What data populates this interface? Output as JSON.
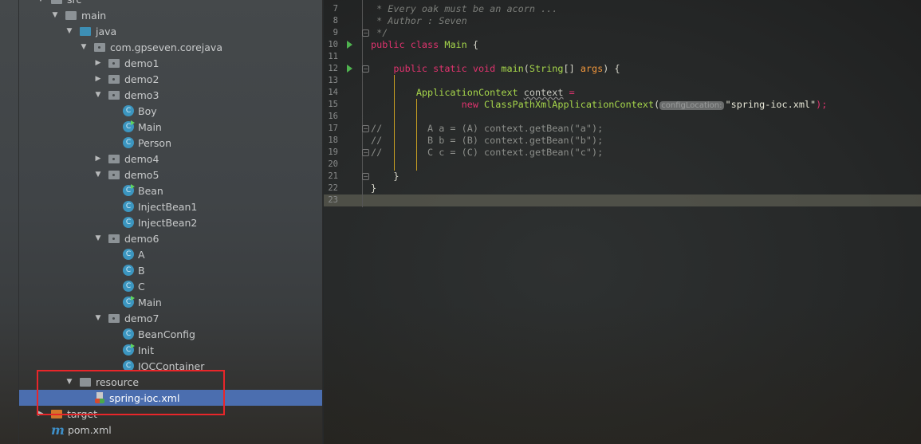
{
  "project_tree": {
    "items": [
      {
        "label": "src",
        "kind": "folder",
        "depth": 0,
        "arrow": "down"
      },
      {
        "label": "main",
        "kind": "folder",
        "depth": 1,
        "arrow": "down"
      },
      {
        "label": "java",
        "kind": "src",
        "depth": 2,
        "arrow": "down"
      },
      {
        "label": "com.gpseven.corejava",
        "kind": "pkg",
        "depth": 3,
        "arrow": "down"
      },
      {
        "label": "demo1",
        "kind": "pkg",
        "depth": 4,
        "arrow": "right"
      },
      {
        "label": "demo2",
        "kind": "pkg",
        "depth": 4,
        "arrow": "right"
      },
      {
        "label": "demo3",
        "kind": "pkg",
        "depth": 4,
        "arrow": "down"
      },
      {
        "label": "Boy",
        "kind": "class",
        "depth": 5
      },
      {
        "label": "Main",
        "kind": "class-run",
        "depth": 5
      },
      {
        "label": "Person",
        "kind": "class",
        "depth": 5
      },
      {
        "label": "demo4",
        "kind": "pkg",
        "depth": 4,
        "arrow": "right"
      },
      {
        "label": "demo5",
        "kind": "pkg",
        "depth": 4,
        "arrow": "down"
      },
      {
        "label": "Bean",
        "kind": "class-run",
        "depth": 5
      },
      {
        "label": "InjectBean1",
        "kind": "class",
        "depth": 5
      },
      {
        "label": "InjectBean2",
        "kind": "class",
        "depth": 5
      },
      {
        "label": "demo6",
        "kind": "pkg",
        "depth": 4,
        "arrow": "down"
      },
      {
        "label": "A",
        "kind": "class",
        "depth": 5
      },
      {
        "label": "B",
        "kind": "class",
        "depth": 5
      },
      {
        "label": "C",
        "kind": "class",
        "depth": 5
      },
      {
        "label": "Main",
        "kind": "class-run",
        "depth": 5
      },
      {
        "label": "demo7",
        "kind": "pkg",
        "depth": 4,
        "arrow": "down"
      },
      {
        "label": "BeanConfig",
        "kind": "class",
        "depth": 5
      },
      {
        "label": "Init",
        "kind": "class-run",
        "depth": 5
      },
      {
        "label": "IOCContainer",
        "kind": "class",
        "depth": 5
      },
      {
        "label": "resource",
        "kind": "folder",
        "depth": 2,
        "arrow": "down"
      },
      {
        "label": "spring-ioc.xml",
        "kind": "xml",
        "depth": 3,
        "selected": true
      },
      {
        "label": "target",
        "kind": "target",
        "depth": 0,
        "arrow": "right"
      },
      {
        "label": "pom.xml",
        "kind": "maven",
        "depth": 0
      }
    ],
    "class_icon_letter": "C",
    "maven_icon_letter": "m",
    "selection_color": "#4b6eaf",
    "highlight_box_color": "#e8262a"
  },
  "editor": {
    "lines": [
      {
        "n": "7",
        "tokens": [
          [
            " * Every oak must be an acorn ...",
            "cmt"
          ]
        ]
      },
      {
        "n": "8",
        "tokens": [
          [
            " * Author : Seven",
            "cmt"
          ]
        ]
      },
      {
        "n": "9",
        "tokens": [
          [
            " */",
            "cmt"
          ]
        ]
      },
      {
        "n": "10",
        "tokens": [
          [
            "public class ",
            "kw"
          ],
          [
            "Main",
            "type"
          ],
          [
            " {",
            "plain"
          ]
        ]
      },
      {
        "n": "11",
        "tokens": []
      },
      {
        "n": "12",
        "tokens": [
          [
            "    public static void ",
            "kw"
          ],
          [
            "main",
            "type"
          ],
          [
            "(",
            "plain"
          ],
          [
            "String",
            "type"
          ],
          [
            "[] ",
            "plain"
          ],
          [
            "args",
            "param"
          ],
          [
            ") {",
            "plain"
          ]
        ]
      },
      {
        "n": "13",
        "tokens": []
      },
      {
        "n": "14",
        "tokens": [
          [
            "        ApplicationContext ",
            "type"
          ],
          [
            "context",
            "warn"
          ],
          [
            " =",
            "kw"
          ]
        ]
      },
      {
        "n": "15",
        "tokens": [
          [
            "                new ",
            "kw"
          ],
          [
            "ClassPathXmlApplicationContext",
            "type"
          ],
          [
            "(",
            "plain"
          ],
          [
            "configLocation:",
            "hint"
          ],
          [
            "\"spring-ioc.xml\"",
            "str"
          ],
          [
            ");",
            "kw"
          ]
        ]
      },
      {
        "n": "16",
        "tokens": []
      },
      {
        "n": "17",
        "tokens": [
          [
            "//        A a = (A) context.getBean(\"a\");",
            "dim"
          ]
        ]
      },
      {
        "n": "18",
        "tokens": [
          [
            "//        B b = (B) context.getBean(\"b\");",
            "dim"
          ]
        ]
      },
      {
        "n": "19",
        "tokens": [
          [
            "//        C c = (C) context.getBean(\"c\");",
            "dim"
          ]
        ]
      },
      {
        "n": "20",
        "tokens": []
      },
      {
        "n": "21",
        "tokens": [
          [
            "    }",
            "plain"
          ]
        ]
      },
      {
        "n": "22",
        "tokens": [
          [
            "}",
            "plain"
          ]
        ]
      },
      {
        "n": "23",
        "tokens": []
      }
    ],
    "current_line": "23",
    "run_gutter_lines": [
      "10",
      "12"
    ],
    "fold_lines": [
      "9",
      "12",
      "17",
      "19",
      "21"
    ]
  }
}
